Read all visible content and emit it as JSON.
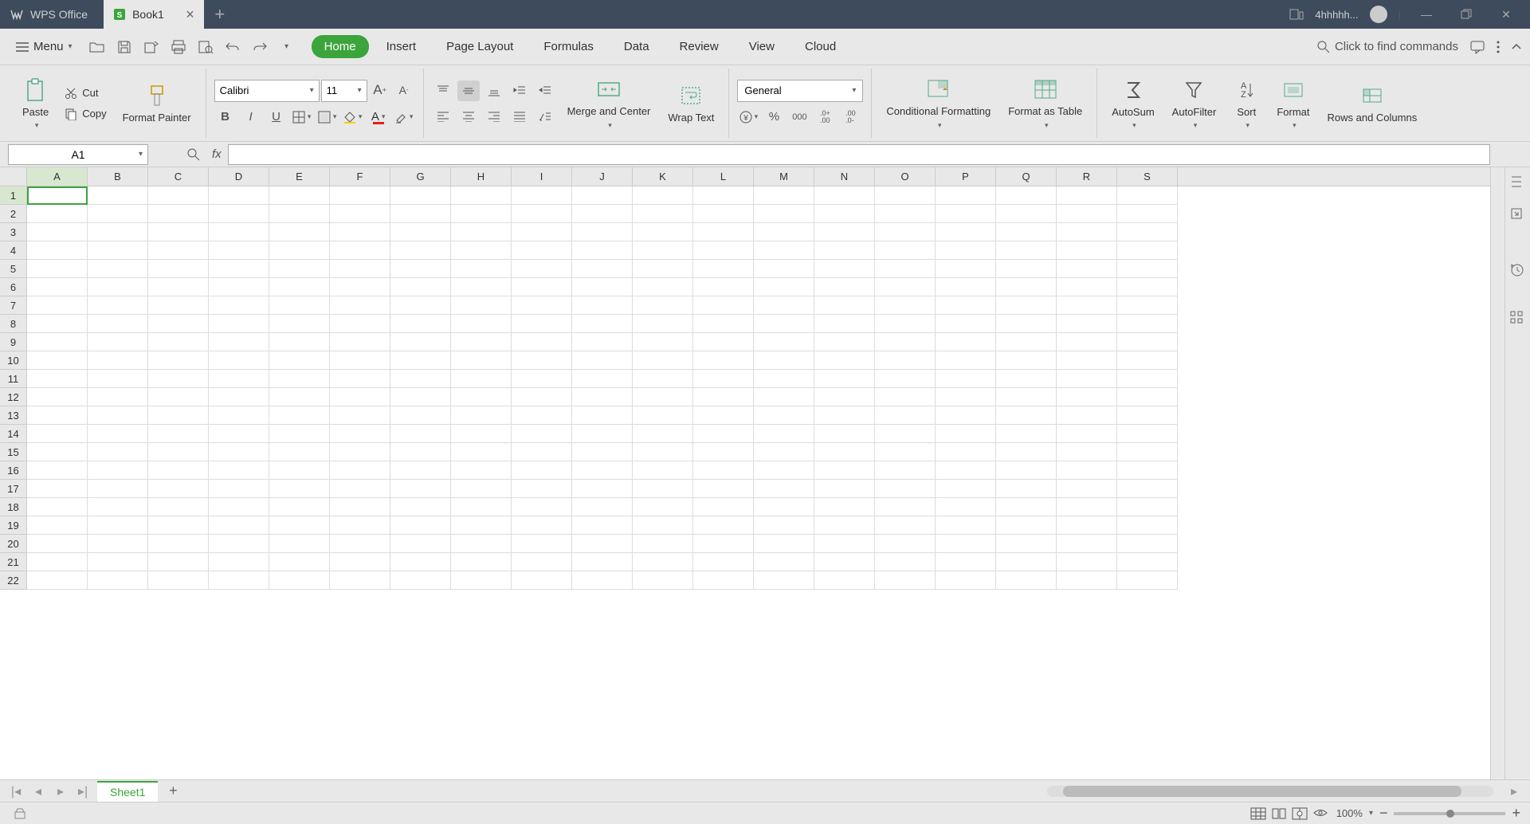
{
  "app": {
    "name": "WPS Office"
  },
  "titlebar": {
    "tab": {
      "name": "Book1"
    },
    "user": "4hhhhh..."
  },
  "menu": {
    "label": "Menu"
  },
  "ribbon_tabs": {
    "home": "Home",
    "insert": "Insert",
    "page_layout": "Page Layout",
    "formulas": "Formulas",
    "data": "Data",
    "review": "Review",
    "view": "View",
    "cloud": "Cloud"
  },
  "search": {
    "placeholder": "Click to find commands"
  },
  "clipboard": {
    "paste": "Paste",
    "cut": "Cut",
    "copy": "Copy",
    "format_painter": "Format Painter"
  },
  "font": {
    "name": "Calibri",
    "size": "11"
  },
  "alignment": {
    "merge": "Merge and Center",
    "wrap": "Wrap Text"
  },
  "number": {
    "format": "General"
  },
  "styles": {
    "conditional": "Conditional Formatting",
    "table": "Format as Table"
  },
  "editing": {
    "autosum": "AutoSum",
    "autofilter": "AutoFilter",
    "sort": "Sort",
    "format": "Format",
    "rowscols": "Rows and Columns"
  },
  "formula_bar": {
    "cell_ref": "A1",
    "fx": "fx"
  },
  "columns": [
    "A",
    "B",
    "C",
    "D",
    "E",
    "F",
    "G",
    "H",
    "I",
    "J",
    "K",
    "L",
    "M",
    "N",
    "O",
    "P",
    "Q",
    "R",
    "S"
  ],
  "rows": [
    "1",
    "2",
    "3",
    "4",
    "5",
    "6",
    "7",
    "8",
    "9",
    "10",
    "11",
    "12",
    "13",
    "14",
    "15",
    "16",
    "17",
    "18",
    "19",
    "20",
    "21",
    "22"
  ],
  "sheets": {
    "sheet1": "Sheet1"
  },
  "status": {
    "zoom": "100%"
  }
}
